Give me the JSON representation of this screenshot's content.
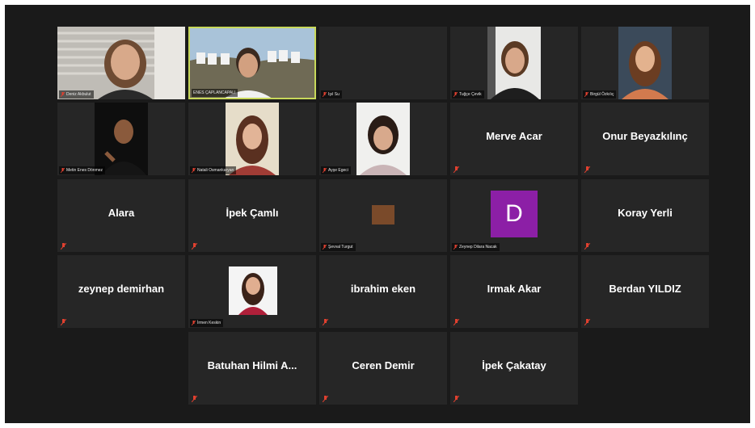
{
  "meeting": {
    "participants": [
      {
        "name": "Deniz Akbulut",
        "display": "tag",
        "video": "photo-blinds"
      },
      {
        "name": "ENES ÇAPLANCAPALI",
        "display": "tag",
        "video": "photo-hollywood",
        "active": true
      },
      {
        "name": "Işıl Su",
        "display": "tag",
        "video": "none"
      },
      {
        "name": "Tuğçe Çevik",
        "display": "tag",
        "video": "photo-woman-1"
      },
      {
        "name": "Birgül Özkılıç",
        "display": "tag",
        "video": "photo-woman-2"
      },
      {
        "name": "Metin Enes Dönmez",
        "display": "tag",
        "video": "photo-man-dark"
      },
      {
        "name": "Natali Osmankaryan",
        "display": "tag",
        "video": "photo-woman-3"
      },
      {
        "name": "Ayşe Egeci",
        "display": "tag",
        "video": "photo-girl"
      },
      {
        "name": "Merve Acar",
        "display": "big"
      },
      {
        "name": "Onur Beyazkılınç",
        "display": "big"
      },
      {
        "name": "Alara",
        "display": "big"
      },
      {
        "name": "İpek Çamlı",
        "display": "big"
      },
      {
        "name": "Şevval Turgut",
        "display": "tag",
        "video": "swatch"
      },
      {
        "name": "Zeynep Dilara Nacak",
        "display": "tag",
        "video": "avatar",
        "avatar_letter": "D"
      },
      {
        "name": "Koray Yerli",
        "display": "big"
      },
      {
        "name": "zeynep demirhan",
        "display": "big"
      },
      {
        "name": "İrmen Keskin",
        "display": "tag",
        "video": "photo-small"
      },
      {
        "name": "ibrahim eken",
        "display": "big"
      },
      {
        "name": "Irmak Akar",
        "display": "big"
      },
      {
        "name": "Berdan YILDIZ",
        "display": "big"
      },
      {
        "name": "Batuhan Hilmi A...",
        "display": "big"
      },
      {
        "name": "Ceren Demir",
        "display": "big"
      },
      {
        "name": "İpek Çakatay",
        "display": "big"
      }
    ],
    "colors": {
      "background": "#1a1a1a",
      "tile": "#262626",
      "active_border": "#c8d85a",
      "muted_icon": "#e0402f",
      "avatar": "#8c1fa6"
    },
    "icons": {
      "muted": "mic-muted-icon"
    }
  }
}
